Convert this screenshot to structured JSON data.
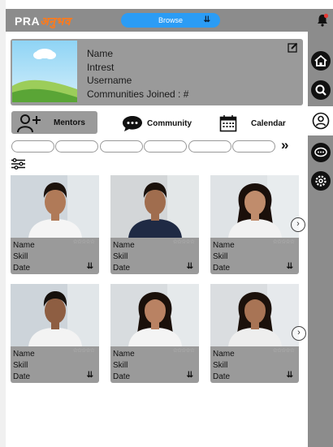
{
  "header": {
    "logo_part1": "PRA",
    "logo_part2": "अनुभव",
    "browse_label": "Browse"
  },
  "profile": {
    "name_label": "Name",
    "interest_label": "Intrest",
    "username_label": "Username",
    "communities_label": "Communities Joined : #"
  },
  "tabs": [
    {
      "label": "Mentors"
    },
    {
      "label": "Community"
    },
    {
      "label": "Calendar"
    }
  ],
  "cards": [
    {
      "name": "Name",
      "skill": "Skill",
      "date": "Date",
      "rating": "☆☆☆☆☆"
    },
    {
      "name": "Name",
      "skill": "Skill",
      "date": "Date",
      "rating": "☆☆☆☆☆"
    },
    {
      "name": "Name",
      "skill": " Skill",
      "date": "Date",
      "rating": "☆☆☆☆☆"
    },
    {
      "name": "Name",
      "skill": "Skill",
      "date": "Date",
      "rating": "☆☆☆☆☆"
    },
    {
      "name": "Name",
      "skill": "Skill",
      "date": "Date",
      "rating": "☆☆☆☆☆"
    },
    {
      "name": "Name",
      "skill": "Skill",
      "date": "Date",
      "rating": "☆☆☆☆☆"
    }
  ],
  "icons": {
    "next": "chevron-right",
    "more": "double-chevron-right"
  }
}
